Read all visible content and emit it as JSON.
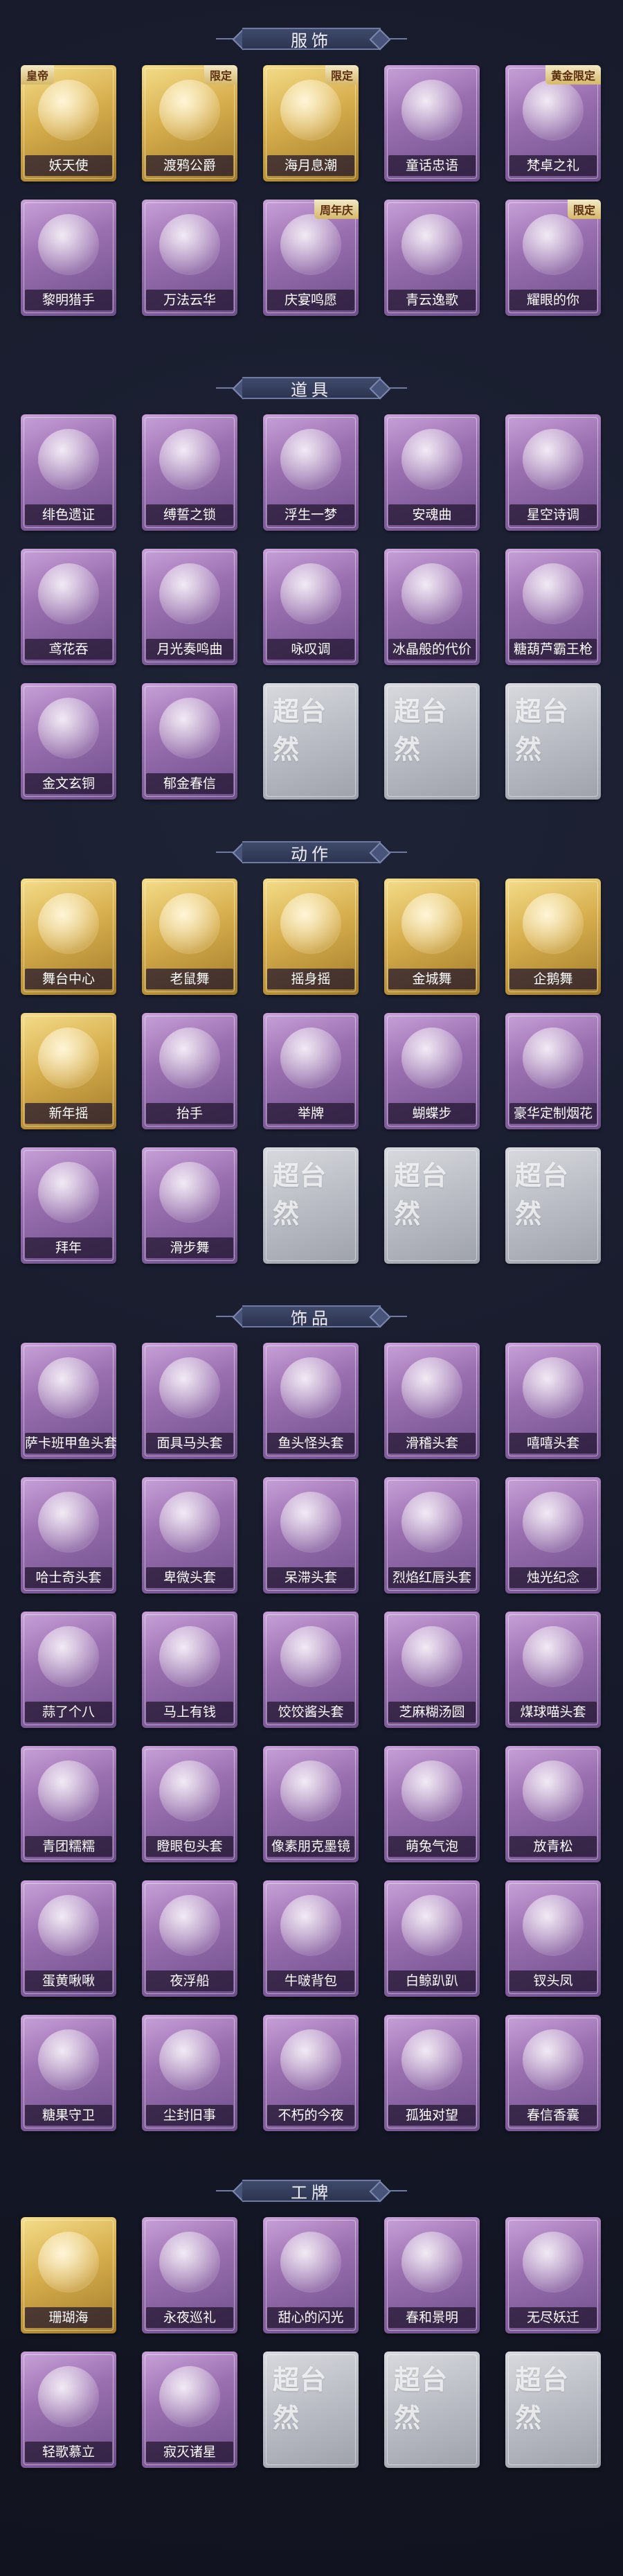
{
  "sections": [
    {
      "title": "服饰",
      "rows": [
        [
          {
            "name": "妖天使",
            "style": "gold",
            "tag": "皇帝"
          },
          {
            "name": "渡鸦公爵",
            "style": "gold",
            "tag": "限定"
          },
          {
            "name": "海月息潮",
            "style": "gold",
            "tag": "限定"
          },
          {
            "name": "童话忠语",
            "style": "purple",
            "tag": ""
          },
          {
            "name": "梵卓之礼",
            "style": "purple",
            "tag": "黄金限定"
          }
        ],
        [
          {
            "name": "黎明猎手",
            "style": "purple",
            "tag": ""
          },
          {
            "name": "万法云华",
            "style": "purple",
            "tag": ""
          },
          {
            "name": "庆宴鸣愿",
            "style": "purple",
            "tag": "周年庆"
          },
          {
            "name": "青云逸歌",
            "style": "purple",
            "tag": ""
          },
          {
            "name": "耀眼的你",
            "style": "purple",
            "tag": "限定"
          }
        ]
      ]
    },
    {
      "title": "道具",
      "rows": [
        [
          {
            "name": "绯色遗证",
            "style": "purple",
            "tag": ""
          },
          {
            "name": "缚誓之锁",
            "style": "purple",
            "tag": ""
          },
          {
            "name": "浮生一梦",
            "style": "purple",
            "tag": ""
          },
          {
            "name": "安魂曲",
            "style": "purple",
            "tag": ""
          },
          {
            "name": "星空诗调",
            "style": "purple",
            "tag": ""
          }
        ],
        [
          {
            "name": "鸢花吞",
            "style": "purple",
            "tag": ""
          },
          {
            "name": "月光奏鸣曲",
            "style": "purple",
            "tag": ""
          },
          {
            "name": "咏叹调",
            "style": "purple",
            "tag": ""
          },
          {
            "name": "冰晶般的代价",
            "style": "purple",
            "tag": ""
          },
          {
            "name": "糖葫芦霸王枪",
            "style": "purple",
            "tag": ""
          }
        ],
        [
          {
            "name": "金文玄铜",
            "style": "purple",
            "tag": ""
          },
          {
            "name": "郁金春信",
            "style": "purple",
            "tag": ""
          },
          {
            "name": "",
            "style": "grey",
            "tag": ""
          },
          {
            "name": "",
            "style": "grey",
            "tag": ""
          },
          {
            "name": "",
            "style": "grey",
            "tag": ""
          }
        ]
      ]
    },
    {
      "title": "动作",
      "rows": [
        [
          {
            "name": "舞台中心",
            "style": "gold",
            "tag": ""
          },
          {
            "name": "老鼠舞",
            "style": "gold",
            "tag": ""
          },
          {
            "name": "摇身摇",
            "style": "gold",
            "tag": ""
          },
          {
            "name": "金城舞",
            "style": "gold",
            "tag": ""
          },
          {
            "name": "企鹅舞",
            "style": "gold",
            "tag": ""
          }
        ],
        [
          {
            "name": "新年摇",
            "style": "gold",
            "tag": ""
          },
          {
            "name": "抬手",
            "style": "purple",
            "tag": ""
          },
          {
            "name": "举牌",
            "style": "purple",
            "tag": ""
          },
          {
            "name": "蝴蝶步",
            "style": "purple",
            "tag": ""
          },
          {
            "name": "豪华定制烟花",
            "style": "purple",
            "tag": ""
          }
        ],
        [
          {
            "name": "拜年",
            "style": "purple",
            "tag": ""
          },
          {
            "name": "滑步舞",
            "style": "purple",
            "tag": ""
          },
          {
            "name": "",
            "style": "grey",
            "tag": ""
          },
          {
            "name": "",
            "style": "grey",
            "tag": ""
          },
          {
            "name": "",
            "style": "grey",
            "tag": ""
          }
        ]
      ]
    },
    {
      "title": "饰品",
      "rows": [
        [
          {
            "name": "萨卡班甲鱼头套",
            "style": "purple",
            "tag": ""
          },
          {
            "name": "面具马头套",
            "style": "purple",
            "tag": ""
          },
          {
            "name": "鱼头怪头套",
            "style": "purple",
            "tag": ""
          },
          {
            "name": "滑稽头套",
            "style": "purple",
            "tag": ""
          },
          {
            "name": "嘻嘻头套",
            "style": "purple",
            "tag": ""
          }
        ],
        [
          {
            "name": "哈士奇头套",
            "style": "purple",
            "tag": ""
          },
          {
            "name": "卑微头套",
            "style": "purple",
            "tag": ""
          },
          {
            "name": "呆滞头套",
            "style": "purple",
            "tag": ""
          },
          {
            "name": "烈焰红唇头套",
            "style": "purple",
            "tag": ""
          },
          {
            "name": "烛光纪念",
            "style": "purple",
            "tag": ""
          }
        ],
        [
          {
            "name": "蒜了个八",
            "style": "purple",
            "tag": ""
          },
          {
            "name": "马上有钱",
            "style": "purple",
            "tag": ""
          },
          {
            "name": "饺饺酱头套",
            "style": "purple",
            "tag": ""
          },
          {
            "name": "芝麻糊汤圆",
            "style": "purple",
            "tag": ""
          },
          {
            "name": "煤球喵头套",
            "style": "purple",
            "tag": ""
          }
        ],
        [
          {
            "name": "青团糯糯",
            "style": "purple",
            "tag": ""
          },
          {
            "name": "瞪眼包头套",
            "style": "purple",
            "tag": ""
          },
          {
            "name": "像素朋克墨镜",
            "style": "purple",
            "tag": ""
          },
          {
            "name": "萌兔气泡",
            "style": "purple",
            "tag": ""
          },
          {
            "name": "放青松",
            "style": "purple",
            "tag": ""
          }
        ],
        [
          {
            "name": "蛋黄啾啾",
            "style": "purple",
            "tag": ""
          },
          {
            "name": "夜浮船",
            "style": "purple",
            "tag": ""
          },
          {
            "name": "牛啵背包",
            "style": "purple",
            "tag": ""
          },
          {
            "name": "白鲸趴趴",
            "style": "purple",
            "tag": ""
          },
          {
            "name": "钗头凤",
            "style": "purple",
            "tag": ""
          }
        ],
        [
          {
            "name": "糖果守卫",
            "style": "purple",
            "tag": ""
          },
          {
            "name": "尘封旧事",
            "style": "purple",
            "tag": ""
          },
          {
            "name": "不朽的今夜",
            "style": "purple",
            "tag": ""
          },
          {
            "name": "孤独对望",
            "style": "purple",
            "tag": ""
          },
          {
            "name": "春信香囊",
            "style": "purple",
            "tag": ""
          }
        ]
      ]
    },
    {
      "title": "工牌",
      "rows": [
        [
          {
            "name": "珊瑚海",
            "style": "gold",
            "tag": ""
          },
          {
            "name": "永夜巡礼",
            "style": "purple",
            "tag": ""
          },
          {
            "name": "甜心的闪光",
            "style": "purple",
            "tag": ""
          },
          {
            "name": "春和景明",
            "style": "purple",
            "tag": ""
          },
          {
            "name": "无尽妖迁",
            "style": "purple",
            "tag": ""
          }
        ],
        [
          {
            "name": "轻歌慕立",
            "style": "purple",
            "tag": ""
          },
          {
            "name": "寂灭诸星",
            "style": "purple",
            "tag": ""
          },
          {
            "name": "",
            "style": "grey",
            "tag": ""
          },
          {
            "name": "",
            "style": "grey",
            "tag": ""
          },
          {
            "name": "",
            "style": "grey",
            "tag": ""
          }
        ]
      ]
    }
  ],
  "placeholder_watermark": "超台然"
}
